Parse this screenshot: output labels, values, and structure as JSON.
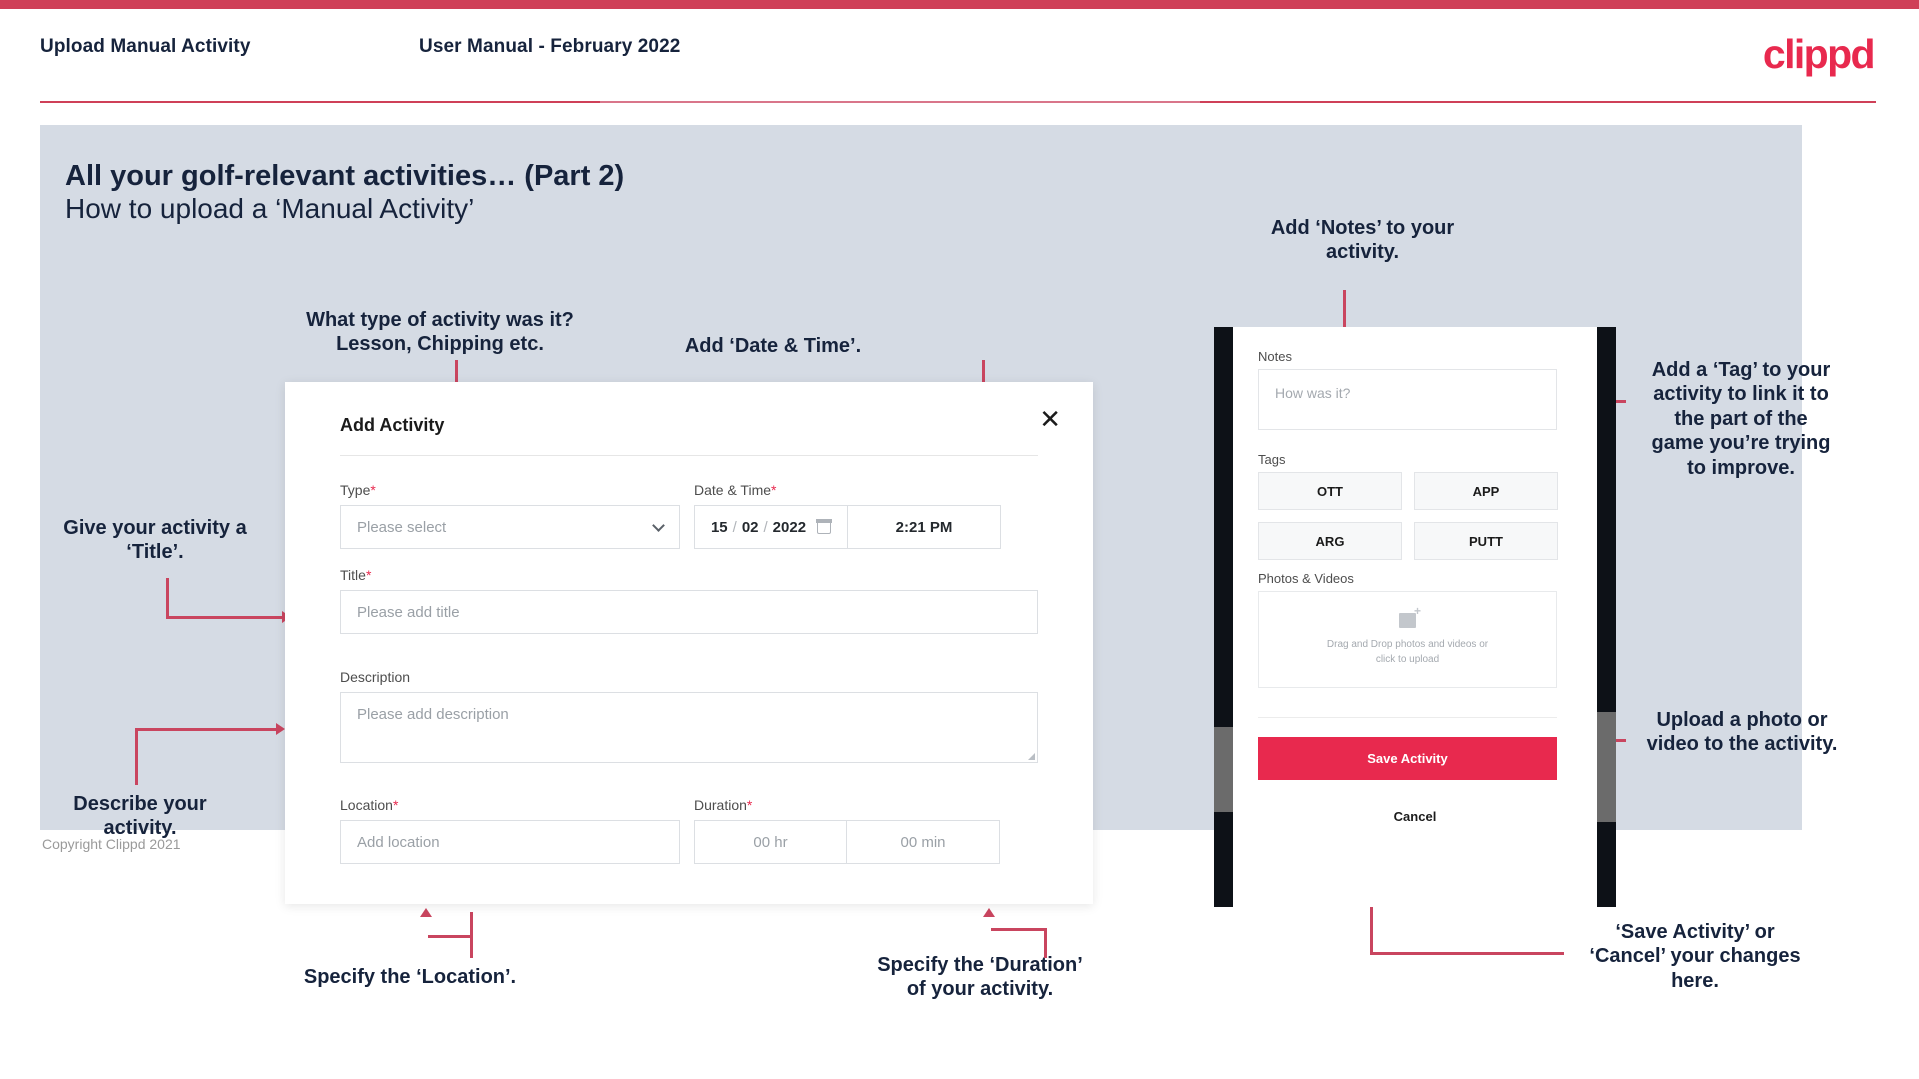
{
  "header": {
    "left_title": "Upload Manual Activity",
    "middle_title": "User Manual - February 2022",
    "logo": "clippd"
  },
  "slide": {
    "title": "All your golf-relevant activities… (Part 2)",
    "subtitle": "How to upload a ‘Manual Activity’"
  },
  "annotations": {
    "type": "What type of activity was it?\nLesson, Chipping etc.",
    "datetime": "Add ‘Date & Time’.",
    "title": "Give your activity a\n‘Title’.",
    "description": "Describe your\nactivity.",
    "location": "Specify the ‘Location’.",
    "duration": "Specify the ‘Duration’\nof your activity.",
    "notes": "Add ‘Notes’ to your\nactivity.",
    "tags": "Add a ‘Tag’ to your\nactivity to link it to\nthe part of the\ngame you’re trying\nto improve.",
    "photos": "Upload a photo or\nvideo to the activity.",
    "save_cancel": "‘Save Activity’ or\n‘Cancel’ your changes\nhere."
  },
  "dialog": {
    "title": "Add Activity",
    "close_icon": "close-icon",
    "fields": {
      "type": {
        "label": "Type",
        "required": "*",
        "placeholder": "Please select"
      },
      "datetime": {
        "label": "Date & Time",
        "required": "*",
        "day": "15",
        "month": "02",
        "year": "2022",
        "sep": "/",
        "time": "2:21 PM"
      },
      "title": {
        "label": "Title",
        "required": "*",
        "placeholder": "Please add title"
      },
      "description": {
        "label": "Description",
        "placeholder": "Please add description"
      },
      "location": {
        "label": "Location",
        "required": "*",
        "placeholder": "Add location"
      },
      "duration": {
        "label": "Duration",
        "required": "*",
        "hours_placeholder": "00 hr",
        "minutes_placeholder": "00 min"
      }
    }
  },
  "phone": {
    "notes": {
      "label": "Notes",
      "placeholder": "How was it?"
    },
    "tags": {
      "label": "Tags",
      "items": [
        "OTT",
        "APP",
        "ARG",
        "PUTT"
      ]
    },
    "photos": {
      "label": "Photos & Videos",
      "drop_line1": "Drag and Drop photos and videos or",
      "drop_line2": "click to upload",
      "icon": "image-add-icon"
    },
    "save_label": "Save Activity",
    "cancel_label": "Cancel"
  },
  "footer": {
    "copyright": "Copyright Clippd 2021"
  },
  "colors": {
    "brand_pink": "#e8294e",
    "accent_rule": "#cf4058",
    "arrow": "#c9455f",
    "slide_bg": "#d5dbe4",
    "text_dark": "#16233c"
  }
}
